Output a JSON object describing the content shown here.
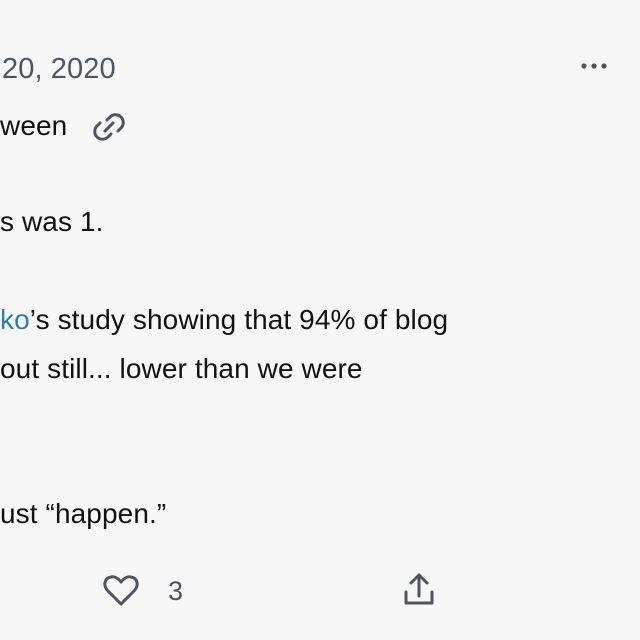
{
  "post": {
    "date_fragment": "20, 2020",
    "menu_icon": "more-horizontal-icon",
    "lines": [
      "ween",
      "s was 1.",
      "’s study showing that 94% of blog",
      "out still... lower than we were",
      "ust “happen.”"
    ],
    "mention_fragment": "ko",
    "link_icon": "link-icon",
    "like_icon": "heart-icon",
    "like_count": "3",
    "share_icon": "share-icon"
  }
}
